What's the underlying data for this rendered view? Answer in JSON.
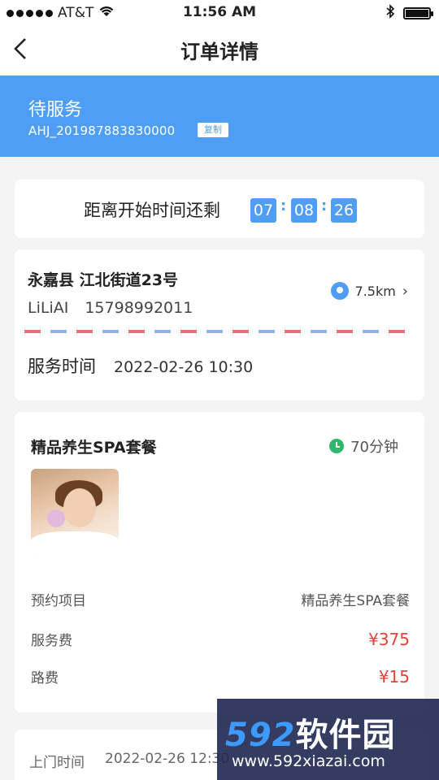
{
  "status_bar": {
    "carrier": "AT&T",
    "time": "11:56 AM"
  },
  "nav": {
    "back_icon": "chevron-left",
    "title": "订单详情"
  },
  "banner": {
    "status": "待服务",
    "order_id": "AHJ_201987883830000",
    "copy_label": "复制",
    "color": "#4e9ef5"
  },
  "countdown": {
    "label": "距离开始时间还剩",
    "hours": "07",
    "minutes": "08",
    "seconds": "26",
    "separator": ":"
  },
  "address": {
    "text": "永嘉县 江北街道23号",
    "contact_name": "LiLiAI",
    "phone": "15798992011",
    "distance": "7.5km",
    "service_time_label": "服务时间",
    "service_time": "2022-02-26 10:30"
  },
  "package": {
    "name": "精品养生SPA套餐",
    "duration": "70分钟",
    "rows": [
      {
        "label": "预约项目",
        "value": "精品养生SPA套餐"
      },
      {
        "label": "服务费",
        "value": "¥375"
      },
      {
        "label": "路费",
        "value": "¥15"
      }
    ],
    "price_color": "#e8413a"
  },
  "bottom": {
    "label": "上门时间",
    "value": "2022-02-26 12:30"
  },
  "watermark": {
    "brand_num": "592",
    "brand_cn": "软件园",
    "url": "www.592xiazai.com"
  }
}
